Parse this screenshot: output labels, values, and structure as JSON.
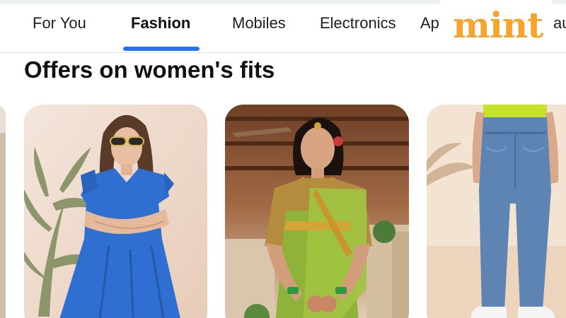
{
  "tabs": [
    {
      "label": "For You",
      "active": false
    },
    {
      "label": "Fashion",
      "active": true
    },
    {
      "label": "Mobiles",
      "active": false
    },
    {
      "label": "Electronics",
      "active": false
    },
    {
      "label": "Ap",
      "active": false
    },
    {
      "label": "au",
      "active": false
    }
  ],
  "watermark": {
    "text": "mint"
  },
  "section": {
    "title": "Offers on women's fits"
  },
  "colors": {
    "accent": "#2874f0",
    "watermark": "#f7a42c"
  },
  "products": [
    {
      "icon": "woman-blue-dress-image"
    },
    {
      "icon": "woman-silk-saree-image"
    },
    {
      "icon": "woman-jeans-image"
    }
  ]
}
